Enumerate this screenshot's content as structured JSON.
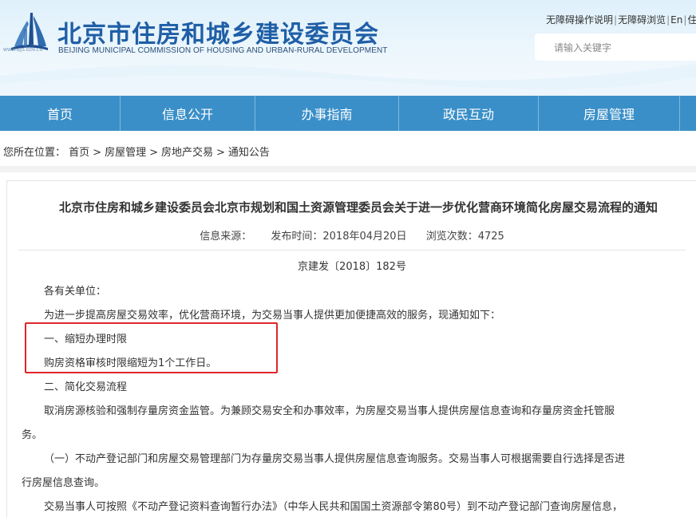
{
  "header": {
    "logo_caption": "WWW.BJJS.GOV.CN",
    "title": "北京市住房和城乡建设委员会",
    "subtitle": "BEIJING MUNICIPAL COMMISSION OF HOUSING AND URBAN-RURAL DEVELOPMENT",
    "top_links": [
      "无障碍操作说明",
      "无障碍浏览",
      "En",
      "住"
    ],
    "search_placeholder": "请输入关键字",
    "colors": {
      "title": "#1f5fa6",
      "nav": "#3a8fc8"
    }
  },
  "nav": {
    "items": [
      "首页",
      "信息公开",
      "办事指南",
      "政民互动",
      "房屋管理",
      ""
    ]
  },
  "breadcrumb": {
    "prefix": "您所在位置：",
    "items": [
      "首页",
      "房屋管理",
      "房地产交易",
      "通知公告"
    ],
    "arrow": ">"
  },
  "article": {
    "title": "北京市住房和城乡建设委员会北京市规划和国土资源管理委员会关于进一步优化营商环境简化房屋交易流程的通知",
    "source_label": "信息来源：",
    "date_label": "发布时间：2018年04月20日",
    "views_label": "浏览次数：4725",
    "doc_number": "京建发〔2018〕182号",
    "paragraphs": [
      "各有关单位：",
      "为进一步提高房屋交易效率，优化营商环境，为交易当事人提供更加便捷高效的服务，现通知如下：",
      "一、缩短办理时限",
      "购房资格审核时限缩短为1个工作日。",
      "二、简化交易流程",
      "取消房源核验和强制存量房资金监管。为兼顾交易安全和办事效率，为房屋交易当事人提供房屋信息查询和存量房资金托管服",
      "务。",
      "（一）不动产登记部门和房屋交易管理部门为存量房交易当事人提供房屋信息查询服务。交易当事人可根据需要自行选择是否进",
      "行房屋信息查询。",
      "交易当事人可按照《不动产登记资料查询暂行办法》（中华人民共和国国土资源部令第80号）到不动产登记部门查询房屋信息，"
    ],
    "highlight_color": "#e0252b"
  }
}
